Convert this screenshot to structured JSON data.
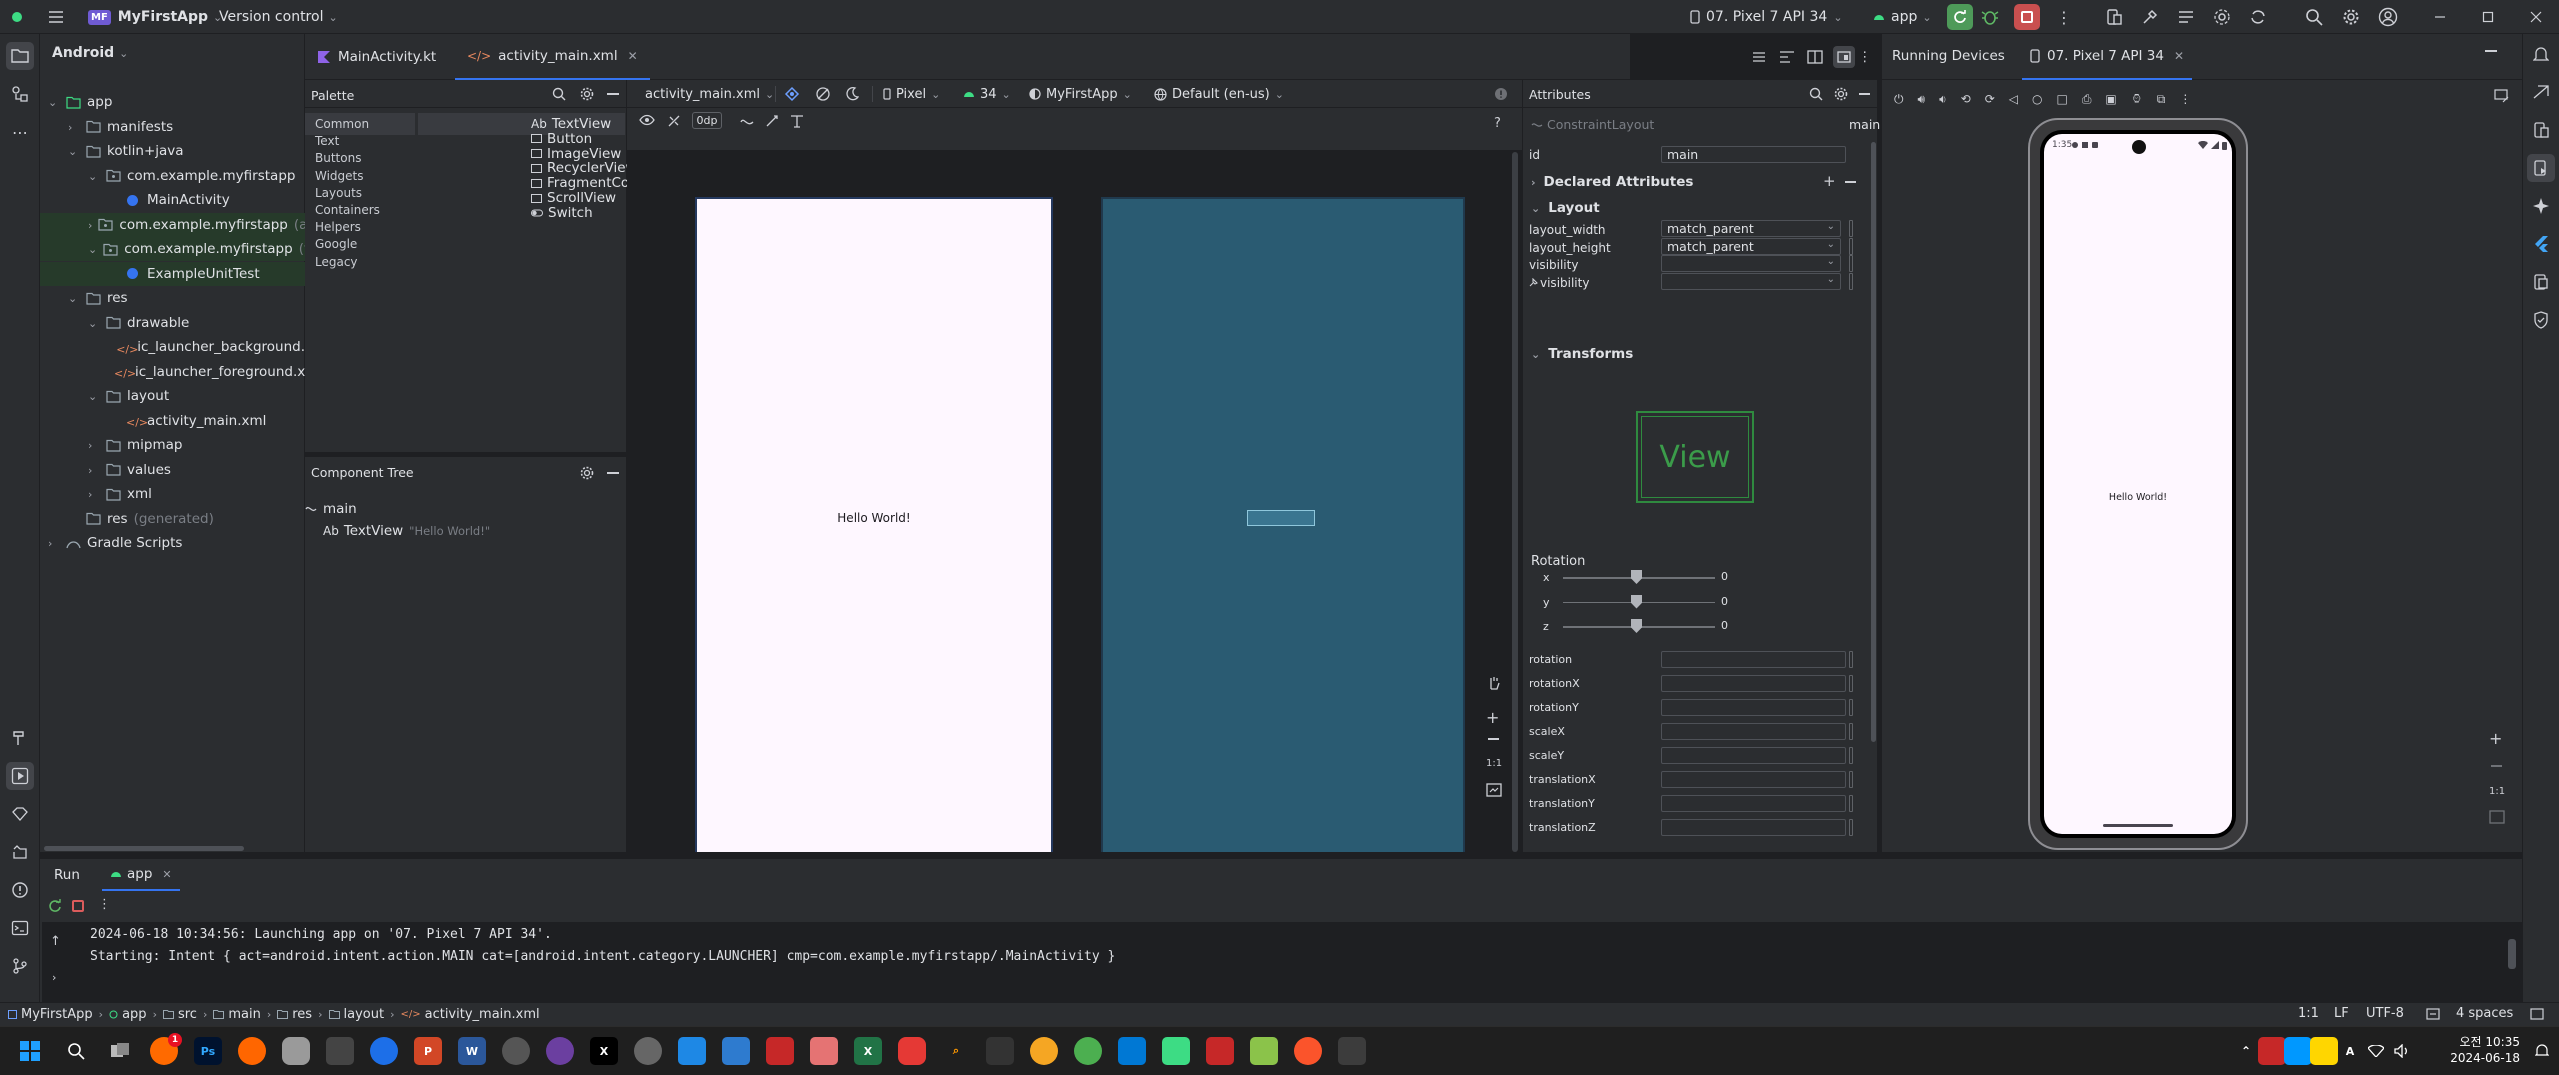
{
  "window": {
    "project_badge": "MF",
    "project_name": "MyFirstApp",
    "vcs": "Version control",
    "device_selector": "07. Pixel 7 API 34",
    "run_config": "app"
  },
  "project_panel": {
    "view_mode": "Android",
    "tree": [
      {
        "label": "app",
        "gray": ""
      },
      {
        "label": "manifests",
        "gray": ""
      },
      {
        "label": "kotlin+java",
        "gray": ""
      },
      {
        "label": "com.example.myfirstapp",
        "gray": ""
      },
      {
        "label": "MainActivity",
        "gray": ""
      },
      {
        "label": "com.example.myfirstapp",
        "gray": "(an"
      },
      {
        "label": "com.example.myfirstapp",
        "gray": "(te"
      },
      {
        "label": "ExampleUnitTest",
        "gray": ""
      },
      {
        "label": "res",
        "gray": ""
      },
      {
        "label": "drawable",
        "gray": ""
      },
      {
        "label": "ic_launcher_background.",
        "gray": ""
      },
      {
        "label": "ic_launcher_foreground.x",
        "gray": ""
      },
      {
        "label": "layout",
        "gray": ""
      },
      {
        "label": "activity_main.xml",
        "gray": ""
      },
      {
        "label": "mipmap",
        "gray": ""
      },
      {
        "label": "values",
        "gray": ""
      },
      {
        "label": "xml",
        "gray": ""
      },
      {
        "label": "res",
        "gray": "(generated)"
      },
      {
        "label": "Gradle Scripts",
        "gray": ""
      }
    ]
  },
  "editor_tabs": [
    {
      "label": "MainActivity.kt"
    },
    {
      "label": "activity_main.xml"
    }
  ],
  "palette": {
    "title": "Palette",
    "categories": [
      "Common",
      "Text",
      "Buttons",
      "Widgets",
      "Layouts",
      "Containers",
      "Helpers",
      "Google",
      "Legacy"
    ],
    "items": [
      "TextView",
      "Button",
      "ImageView",
      "RecyclerView",
      "FragmentContainerView",
      "ScrollView",
      "Switch"
    ],
    "ab_glyph": "Ab"
  },
  "component_tree": {
    "title": "Component Tree",
    "root": "main",
    "child_glyph": "Ab",
    "child": "TextView",
    "child_text": "\"Hello World!\""
  },
  "design_toolbar": {
    "file": "activity_main.xml",
    "device": "Pixel",
    "api": "34",
    "theme": "MyFirstApp",
    "locale": "Default (en-us)",
    "margin": "0dp",
    "help": "?"
  },
  "design_canvas": {
    "hello": "Hello World!",
    "zoom_ratio": "1:1"
  },
  "attributes": {
    "title": "Attributes",
    "class_name": "ConstraintLayout",
    "id_value": "main",
    "labels": {
      "id": "id",
      "declared": "Declared Attributes",
      "layout": "Layout",
      "transforms": "Transforms",
      "rotation": "Rotation"
    },
    "layout_rows": [
      {
        "label": "layout_width",
        "value": "match_parent"
      },
      {
        "label": "layout_height",
        "value": "match_parent"
      },
      {
        "label": "visibility",
        "value": ""
      },
      {
        "label": "visibility",
        "value": ""
      }
    ],
    "view_preview": "View",
    "rotation_axes": [
      {
        "axis": "x",
        "value": "0"
      },
      {
        "axis": "y",
        "value": "0"
      },
      {
        "axis": "z",
        "value": "0"
      }
    ],
    "transform_fields": [
      "rotation",
      "rotationX",
      "rotationY",
      "scaleX",
      "scaleY",
      "translationX",
      "translationY",
      "translationZ"
    ]
  },
  "running_devices": {
    "title": "Running Devices",
    "tab": "07. Pixel 7 API 34",
    "status_time": "1:35",
    "hello": "Hello World!",
    "zoom_ratio": "1:1"
  },
  "run_panel": {
    "tab_run": "Run",
    "tab_app": "app",
    "log": [
      "2024-06-18 10:34:56: Launching app on '07. Pixel 7 API 34'.",
      "Starting: Intent { act=android.intent.action.MAIN cat=[android.intent.category.LAUNCHER] cmp=com.example.myfirstapp/.MainActivity }"
    ]
  },
  "status_bar": {
    "breadcrumb": [
      "MyFirstApp",
      "app",
      "src",
      "main",
      "res",
      "layout",
      "activity_main.xml"
    ],
    "position": "1:1",
    "line_sep": "LF",
    "encoding": "UTF-8",
    "indent": "4 spaces"
  },
  "taskbar": {
    "clock_time": "오전 10:35",
    "clock_date": "2024-06-18",
    "notification_count": "1"
  }
}
